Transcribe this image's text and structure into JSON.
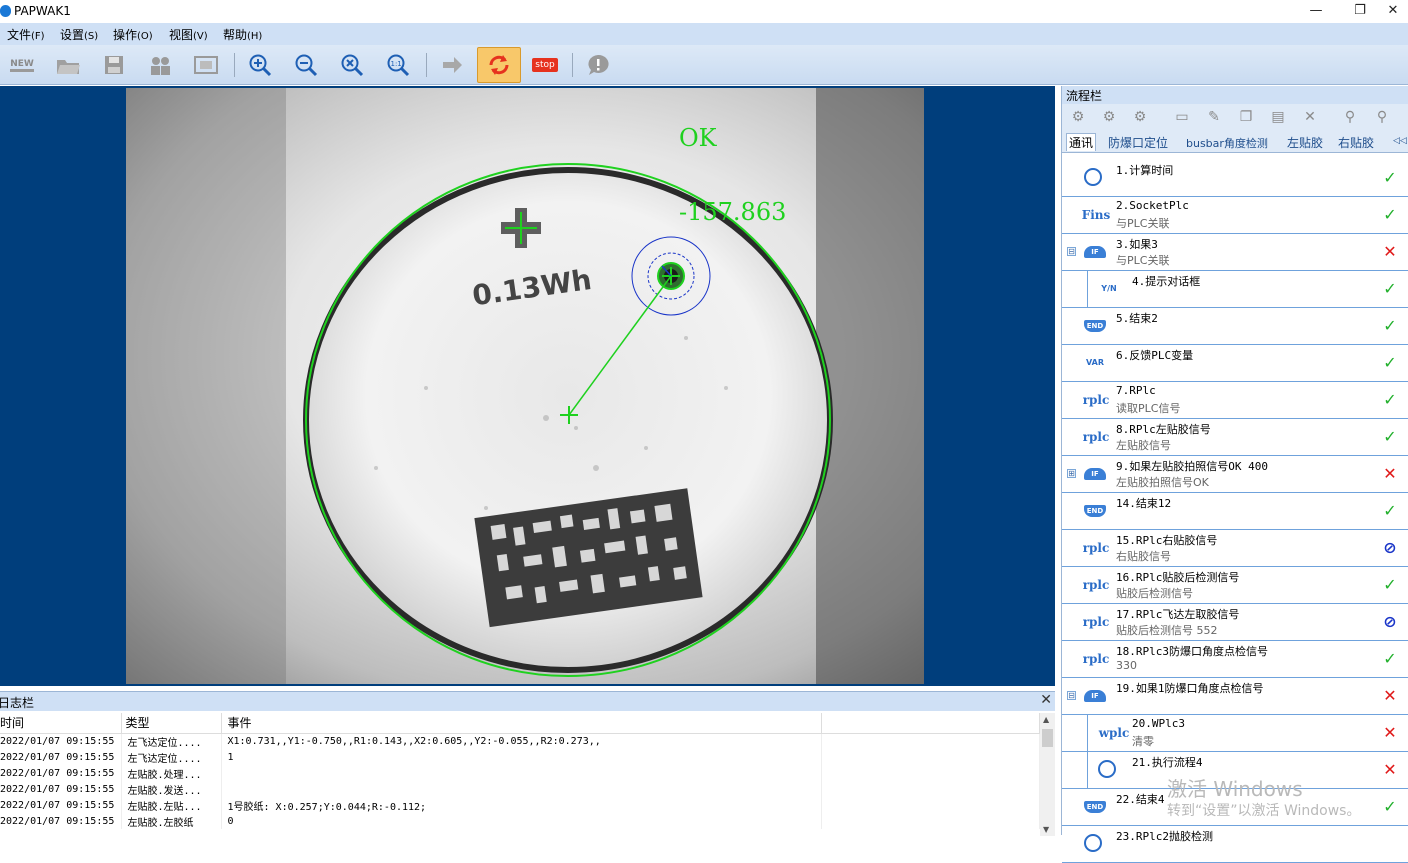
{
  "window": {
    "title": "PAPWAK1",
    "controls": {
      "minimize": "—",
      "maximize": "❐",
      "close": "✕"
    }
  },
  "menu": [
    {
      "label": "文件",
      "key": "(F)"
    },
    {
      "label": "设置",
      "key": "(S)"
    },
    {
      "label": "操作",
      "key": "(O)"
    },
    {
      "label": "视图",
      "key": "(V)"
    },
    {
      "label": "帮助",
      "key": "(H)"
    }
  ],
  "toolbar": {
    "new_label": "NEW",
    "stop_label": "stop",
    "icons": [
      "new-icon",
      "open-folder-icon",
      "save-icon",
      "users-icon",
      "fit-window-icon",
      "zoom-in-icon",
      "zoom-out-icon",
      "zoom-fit-icon",
      "zoom-actual-icon",
      "step-arrow-icon",
      "loop-run-icon",
      "stop-icon",
      "help-bubble-icon"
    ]
  },
  "viewer": {
    "result_text": "OK",
    "angle_text": "-157.863",
    "printed_label": "0.13Wh",
    "colors": {
      "overlay": "#1fd11f",
      "mark": "#1a35c8",
      "background": "#003e7c"
    }
  },
  "log": {
    "title": "日志栏",
    "close": "✕",
    "columns": [
      "时间",
      "类型",
      "事件"
    ],
    "rows": [
      [
        "2022/01/07 09:15:55",
        "左飞达定位....",
        "X1:0.731,,Y1:-0.750,,R1:0.143,,X2:0.605,,Y2:-0.055,,R2:0.273,,"
      ],
      [
        "2022/01/07 09:15:55",
        "左飞达定位....",
        "1"
      ],
      [
        "2022/01/07 09:15:55",
        "左贴胶.处理...",
        ""
      ],
      [
        "2022/01/07 09:15:55",
        "左贴胶.发送...",
        ""
      ],
      [
        "2022/01/07 09:15:55",
        "左贴胶.左贴...",
        "1号胶纸: X:0.257;Y:0.044;R:-0.112;"
      ],
      [
        "2022/01/07 09:15:55",
        "左贴胶.左胶纸",
        "0"
      ]
    ]
  },
  "flow": {
    "title": "流程栏",
    "tabs": [
      "通讯",
      "防爆口定位",
      "busbar角度检测",
      "左贴胶",
      "右贴胶"
    ],
    "tab_scroll": "◁◁",
    "steps": [
      {
        "icon": "clock-icon",
        "icon_text": "",
        "name": "1.计算时间",
        "sub": "",
        "status": "ok",
        "indent": false,
        "expander": ""
      },
      {
        "icon": "fins-icon",
        "icon_text": "Fins",
        "name": "2.SocketPlc",
        "sub": "与PLC关联",
        "status": "ok",
        "indent": false,
        "expander": ""
      },
      {
        "icon": "if-icon",
        "icon_text": "IF",
        "name": "3.如果3",
        "sub": "与PLC关联",
        "status": "ng",
        "indent": false,
        "expander": "⊟"
      },
      {
        "icon": "dialog-icon",
        "icon_text": "Y/N",
        "name": "4.提示对话框",
        "sub": "",
        "status": "ok",
        "indent": true,
        "expander": ""
      },
      {
        "icon": "end-icon",
        "icon_text": "END",
        "name": "5.结束2",
        "sub": "",
        "status": "ok",
        "indent": false,
        "expander": ""
      },
      {
        "icon": "var-icon",
        "icon_text": "VAR",
        "name": "6.反馈PLC变量",
        "sub": "",
        "status": "ok",
        "indent": false,
        "expander": ""
      },
      {
        "icon": "rplc-icon",
        "icon_text": "rplc",
        "name": "7.RPlc",
        "sub": "读取PLC信号",
        "status": "ok",
        "indent": false,
        "expander": ""
      },
      {
        "icon": "rplc-icon",
        "icon_text": "rplc",
        "name": "8.RPlc左贴胶信号",
        "sub": "左贴胶信号",
        "status": "ok",
        "indent": false,
        "expander": ""
      },
      {
        "icon": "if-icon",
        "icon_text": "IF",
        "name": "9.如果左贴胶拍照信号OK  400",
        "sub": "左贴胶拍照信号OK",
        "status": "ng",
        "indent": false,
        "expander": "⊞"
      },
      {
        "icon": "end-icon",
        "icon_text": "END",
        "name": "14.结束12",
        "sub": "",
        "status": "ok",
        "indent": false,
        "expander": ""
      },
      {
        "icon": "rplc-icon",
        "icon_text": "rplc",
        "name": "15.RPlc右贴胶信号",
        "sub": "右贴胶信号",
        "status": "skip",
        "indent": false,
        "expander": ""
      },
      {
        "icon": "rplc-icon",
        "icon_text": "rplc",
        "name": "16.RPlc贴胶后检测信号",
        "sub": "贴胶后检测信号",
        "status": "ok",
        "indent": false,
        "expander": ""
      },
      {
        "icon": "rplc-icon",
        "icon_text": "rplc",
        "name": "17.RPlc飞达左取胶信号",
        "sub": "贴胶后检测信号   552",
        "status": "skip",
        "indent": false,
        "expander": ""
      },
      {
        "icon": "rplc-icon",
        "icon_text": "rplc",
        "name": "18.RPlc3防爆口角度点检信号",
        "sub": "330",
        "status": "ok",
        "indent": false,
        "expander": ""
      },
      {
        "icon": "if-icon",
        "icon_text": "IF",
        "name": "19.如果1防爆口角度点检信号",
        "sub": "",
        "status": "ng",
        "indent": false,
        "expander": "⊟"
      },
      {
        "icon": "wplc-icon",
        "icon_text": "wplc",
        "name": "20.WPlc3",
        "sub": "清零",
        "status": "ng",
        "indent": true,
        "expander": ""
      },
      {
        "icon": "run-flow-icon",
        "icon_text": "",
        "name": "21.执行流程4",
        "sub": "",
        "status": "ng",
        "indent": true,
        "expander": ""
      },
      {
        "icon": "end-icon",
        "icon_text": "END",
        "name": "22.结束4",
        "sub": "",
        "status": "ok",
        "indent": false,
        "expander": ""
      },
      {
        "icon": "rplc-icon",
        "icon_text": "",
        "name": "23.RPlc2抛胶检测",
        "sub": "",
        "status": "",
        "indent": false,
        "expander": ""
      }
    ],
    "status_glyphs": {
      "ok": "✓",
      "ng": "✕",
      "skip": "⊘"
    }
  },
  "watermark": {
    "line1": "激活 Windows",
    "line2": "转到“设置”以激活 Windows。"
  }
}
